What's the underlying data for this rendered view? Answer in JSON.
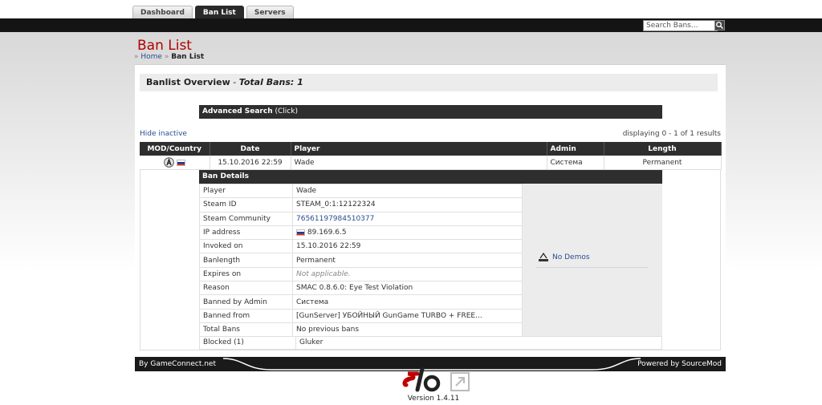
{
  "nav": {
    "tabs": [
      "Dashboard",
      "Ban List",
      "Servers"
    ],
    "active_tab": "Ban List"
  },
  "search": {
    "placeholder": "Search Bans..."
  },
  "page": {
    "title": "Ban List",
    "breadcrumb": {
      "sep": "»",
      "home": "Home",
      "current": "Ban List"
    }
  },
  "overview": {
    "title": "Banlist Overview",
    "dash": " - ",
    "total": "Total Bans: 1"
  },
  "advanced_search": {
    "label": "Advanced Search",
    "hint": "(Click)"
  },
  "hide_inactive": "Hide inactive",
  "displaying": "displaying 0 - 1 of 1 results",
  "table": {
    "headers": [
      "MOD/Country",
      "Date",
      "Player",
      "Admin",
      "Length"
    ],
    "row": {
      "date": "15.10.2016 22:59",
      "player": "Wade",
      "admin": "Система",
      "length": "Permanent"
    }
  },
  "details": {
    "header": "Ban Details",
    "rows": [
      {
        "key": "Player",
        "value": "Wade"
      },
      {
        "key": "Steam ID",
        "value": "STEAM_0:1:12122324"
      },
      {
        "key": "Steam Community",
        "value": "76561197984510377"
      },
      {
        "key": "IP address",
        "value": "89.169.6.5"
      },
      {
        "key": "Invoked on",
        "value": "15.10.2016 22:59"
      },
      {
        "key": "Banlength",
        "value": "Permanent"
      },
      {
        "key": "Expires on",
        "value": "Not applicable."
      },
      {
        "key": "Reason",
        "value": "SMAC 0.8.6.0: Eye Test Violation"
      },
      {
        "key": "Banned by Admin",
        "value": "Система"
      },
      {
        "key": "Banned from",
        "value": "[GunServer] УБОЙНЫЙ GunGame TURBO + FREE..."
      },
      {
        "key": "Total Bans",
        "value": "No previous bans"
      }
    ],
    "blocked": {
      "key": "Blocked (1)",
      "value": "Gluker"
    },
    "demo": "No Demos"
  },
  "footer": {
    "left": "By GameConnect.net",
    "right": "Powered by SourceMod"
  },
  "version": "Version 1.4.11",
  "colors": {
    "accent_red": "#b00000",
    "dark_bar": "#2e2e2e",
    "link_blue": "#2a4d8f"
  }
}
